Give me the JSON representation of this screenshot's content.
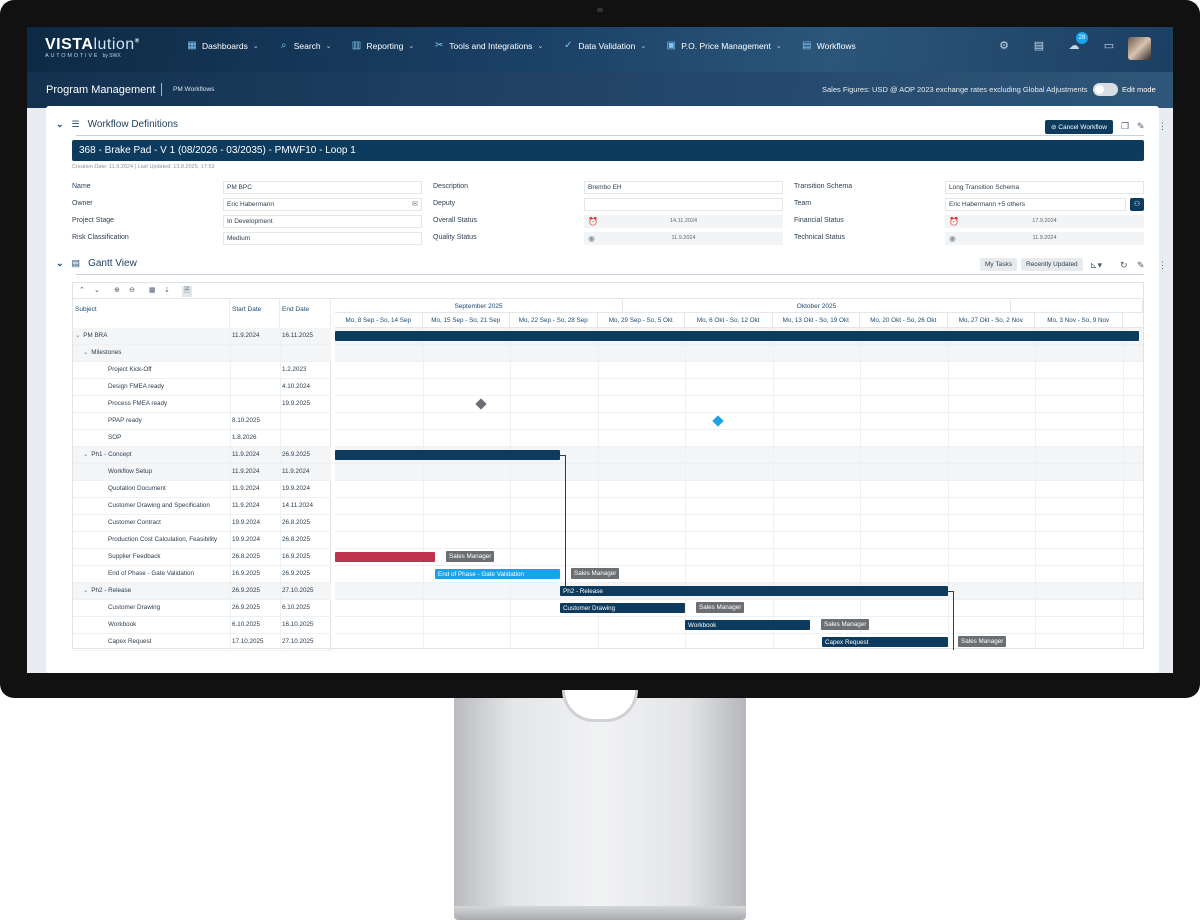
{
  "app": {
    "logo_main": "VISTA",
    "logo_accent": "lution",
    "logo_mark": "®",
    "logo_sub": "AUTOMOTIVE",
    "logo_by": "by SWX"
  },
  "nav": [
    {
      "label": "Dashboards",
      "icon": "dashboard-icon"
    },
    {
      "label": "Search",
      "icon": "search-icon"
    },
    {
      "label": "Reporting",
      "icon": "chart-icon"
    },
    {
      "label": "Tools and Integrations",
      "icon": "tools-icon"
    },
    {
      "label": "Data Validation",
      "icon": "check-icon"
    },
    {
      "label": "P.O. Price Management",
      "icon": "price-icon"
    },
    {
      "label": "Workflows",
      "icon": "workflow-icon"
    }
  ],
  "header": {
    "notification_count": "28"
  },
  "subheader": {
    "title": "Program Management",
    "crumb": "PM Workflows",
    "sales_figures": "Sales Figures: USD @ AOP 2023 exchange rates excluding Global Adjustments",
    "edit_mode": "Edit mode"
  },
  "workflow": {
    "section_title": "Workflow Definitions",
    "cancel_label": "Cancel Workflow",
    "project_title": "368 - Brake Pad - V 1 (08/2026 - 03/2035) - PMWF10 - Loop 1",
    "meta": "Creation Date: 11.9.2024 | Last Updated: 13.8.2025, 17:53",
    "fields": {
      "name_label": "Name",
      "name_value": "PM BPC",
      "owner_label": "Owner",
      "owner_value": "Eric Habermann",
      "stage_label": "Project Stage",
      "stage_value": "In Development",
      "risk_label": "Risk Classification",
      "risk_value": "Medium",
      "desc_label": "Description",
      "desc_value": "Brembo EH",
      "deputy_label": "Deputy",
      "deputy_value": "",
      "overall_label": "Overall Status",
      "overall_value": "14.11.2024",
      "quality_label": "Quality Status",
      "quality_value": "11.9.2024",
      "transition_label": "Transition Schema",
      "transition_value": "Long Transition Schema",
      "team_label": "Team",
      "team_value": "Eric Habermann +5 others",
      "financial_label": "Financial Status",
      "financial_value": "17.9.2024",
      "technical_label": "Technical Status",
      "technical_value": "11.9.2024"
    }
  },
  "gantt": {
    "section_title": "Gantt View",
    "my_tasks": "My Tasks",
    "recently_updated": "Recently Updated",
    "col_subject": "Subject",
    "col_start": "Start Date",
    "col_end": "End Date",
    "months": [
      "September 2025",
      "Oktober 2025"
    ],
    "weeks": [
      "Mo, 8 Sep - So, 14 Sep",
      "Mo, 15 Sep - So, 21 Sep",
      "Mo, 22 Sep - So, 28 Sep",
      "Mo, 29 Sep - So, 5 Okt",
      "Mo, 6 Okt - So, 12 Okt",
      "Mo, 13 Okt - So, 19 Okt",
      "Mo, 20 Okt - So, 26 Okt",
      "Mo, 27 Okt - So, 2 Nov",
      "Mo, 3 Nov - So, 9 Nov",
      "Mo,"
    ],
    "rows": [
      {
        "subject": "PM BRA",
        "start": "11.9.2024",
        "end": "16.11.2025",
        "level": 0,
        "group": true,
        "caret": "⌄"
      },
      {
        "subject": "Milestones",
        "start": "",
        "end": "",
        "level": 1,
        "group": true,
        "caret": "⌄"
      },
      {
        "subject": "Project Kick-Off",
        "start": "",
        "end": "1.2.2023",
        "level": 2,
        "group": false,
        "caret": ""
      },
      {
        "subject": "Design FMEA ready",
        "start": "",
        "end": "4.10.2024",
        "level": 2,
        "group": false,
        "caret": ""
      },
      {
        "subject": "Process FMEA ready",
        "start": "",
        "end": "19.9.2025",
        "level": 2,
        "group": false,
        "caret": ""
      },
      {
        "subject": "PPAP ready",
        "start": "8.10.2025",
        "end": "",
        "level": 2,
        "group": false,
        "caret": ""
      },
      {
        "subject": "SOP",
        "start": "1.8.2026",
        "end": "",
        "level": 2,
        "group": false,
        "caret": ""
      },
      {
        "subject": "Ph1 - Concept",
        "start": "11.9.2024",
        "end": "26.9.2025",
        "level": 1,
        "group": true,
        "caret": "⌄"
      },
      {
        "subject": "Workflow Setup",
        "start": "11.9.2024",
        "end": "11.9.2024",
        "level": 2,
        "group": true,
        "caret": ""
      },
      {
        "subject": "Quotation Document",
        "start": "11.9.2024",
        "end": "19.9.2024",
        "level": 2,
        "group": false,
        "caret": ""
      },
      {
        "subject": "Customer Drawing and Specification",
        "start": "11.9.2024",
        "end": "14.11.2024",
        "level": 2,
        "group": false,
        "caret": ""
      },
      {
        "subject": "Customer Contract",
        "start": "19.9.2024",
        "end": "26.8.2025",
        "level": 2,
        "group": false,
        "caret": ""
      },
      {
        "subject": "Production Cost Calculation, Feasibility",
        "start": "19.9.2024",
        "end": "26.8.2025",
        "level": 2,
        "group": false,
        "caret": ""
      },
      {
        "subject": "Supplier Feedback",
        "start": "26.8.2025",
        "end": "16.9.2025",
        "level": 2,
        "group": false,
        "caret": ""
      },
      {
        "subject": "End of Phase - Gate Validation",
        "start": "16.9.2025",
        "end": "26.9.2025",
        "level": 2,
        "group": false,
        "caret": ""
      },
      {
        "subject": "Ph2 - Release",
        "start": "26.9.2025",
        "end": "27.10.2025",
        "level": 1,
        "group": true,
        "caret": "⌄"
      },
      {
        "subject": "Customer Drawing",
        "start": "26.9.2025",
        "end": "6.10.2025",
        "level": 2,
        "group": false,
        "caret": ""
      },
      {
        "subject": "Workbook",
        "start": "6.10.2025",
        "end": "16.10.2025",
        "level": 2,
        "group": false,
        "caret": ""
      },
      {
        "subject": "Capex Request",
        "start": "17.10.2025",
        "end": "27.10.2025",
        "level": 2,
        "group": false,
        "caret": ""
      }
    ],
    "bar_labels": {
      "gate": "End of Phase - Gate Validation",
      "ph2": "Ph2 - Release",
      "drawing": "Customer Drawing",
      "workbook": "Workbook",
      "capex": "Capex Request",
      "sales_manager": "Sales Manager"
    },
    "colors": {
      "dark": "#0d3b5e",
      "red": "#c0334d",
      "blue": "#1aa3e8",
      "milestone_gray": "#6b6f73"
    }
  }
}
